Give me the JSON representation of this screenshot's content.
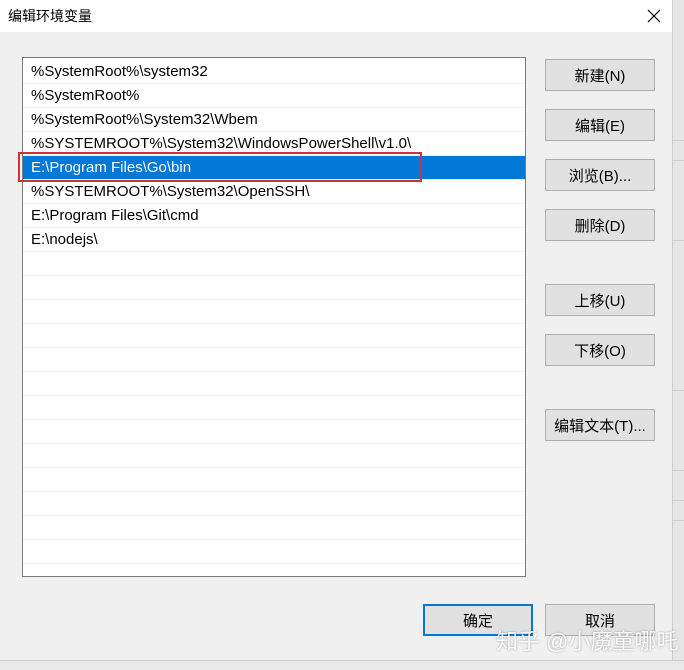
{
  "window": {
    "title": "编辑环境变量",
    "close_icon": "close-icon"
  },
  "path_list": {
    "items": [
      "%SystemRoot%\\system32",
      "%SystemRoot%",
      "%SystemRoot%\\System32\\Wbem",
      "%SYSTEMROOT%\\System32\\WindowsPowerShell\\v1.0\\",
      "E:\\Program Files\\Go\\bin",
      "%SYSTEMROOT%\\System32\\OpenSSH\\",
      "E:\\Program Files\\Git\\cmd",
      "E:\\nodejs\\"
    ],
    "selected_index": 4,
    "selection_color": "#0078d7",
    "annotation_color": "#d0303a"
  },
  "buttons": {
    "new": "新建(N)",
    "edit": "编辑(E)",
    "browse": "浏览(B)...",
    "delete": "删除(D)",
    "move_up": "上移(U)",
    "move_down": "下移(O)",
    "edit_text": "编辑文本(T)..."
  },
  "footer": {
    "ok": "确定",
    "cancel": "取消"
  },
  "watermark": "知乎 @小魔童哪吒"
}
